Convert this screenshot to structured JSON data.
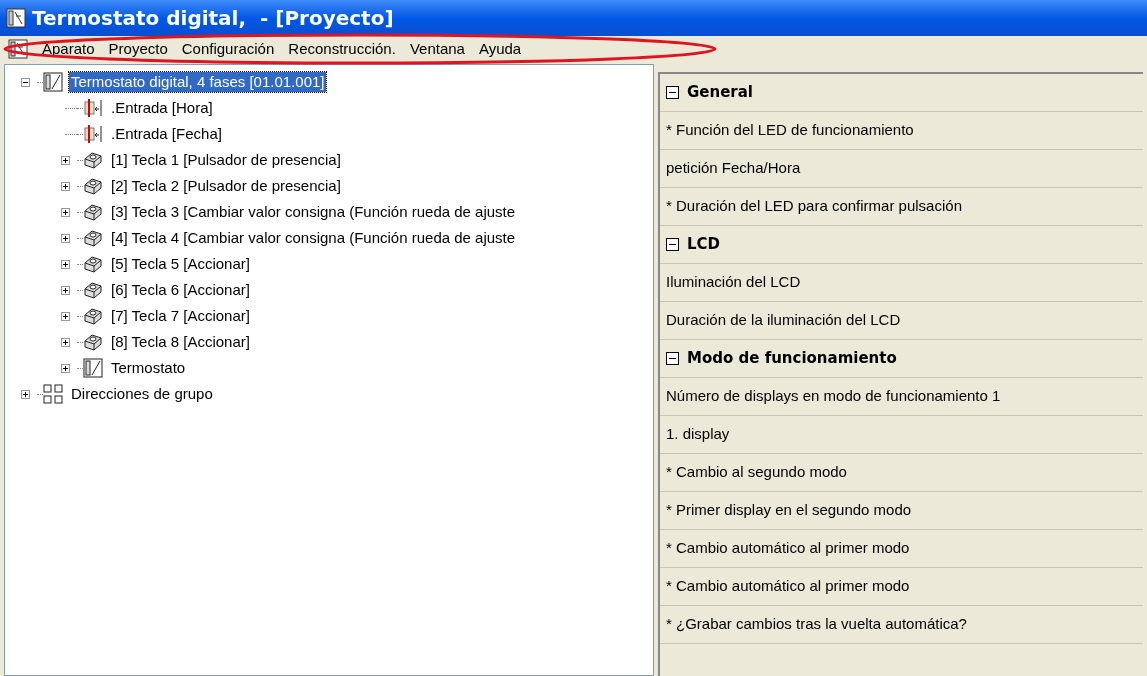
{
  "window": {
    "title": "Termostato digital,  - [Proyecto]"
  },
  "menu": [
    "Aparato",
    "Proyecto",
    "Configuración",
    "Reconstrucción.",
    "Ventana",
    "Ayuda"
  ],
  "annotation": {
    "kind": "ellipse",
    "color": "#e0141e"
  },
  "tree": [
    {
      "label": "Termostato digital, 4 fases [01.01.001]",
      "kind": "device",
      "expanded": true,
      "selected": true,
      "children": [
        {
          "label": ".Entrada [Hora]",
          "kind": "input",
          "selected": false
        },
        {
          "label": ".Entrada [Fecha]",
          "kind": "input",
          "selected": false
        },
        {
          "label": "[1] Tecla 1 [Pulsador de presencia]",
          "kind": "key",
          "expanded": false,
          "selected": false
        },
        {
          "label": "[2] Tecla 2 [Pulsador de presencia]",
          "kind": "key",
          "expanded": false,
          "selected": false
        },
        {
          "label": "[3] Tecla 3 [Cambiar valor consigna (Función rueda de ajuste",
          "kind": "key",
          "expanded": false,
          "selected": false
        },
        {
          "label": "[4] Tecla 4 [Cambiar valor consigna (Función rueda de ajuste",
          "kind": "key",
          "expanded": false,
          "selected": false
        },
        {
          "label": "[5] Tecla 5 [Accionar]",
          "kind": "key",
          "expanded": false,
          "selected": false
        },
        {
          "label": "[6] Tecla 6 [Accionar]",
          "kind": "key",
          "expanded": false,
          "selected": false
        },
        {
          "label": "[7] Tecla 7 [Accionar]",
          "kind": "key",
          "expanded": false,
          "selected": false
        },
        {
          "label": "[8] Tecla 8 [Accionar]",
          "kind": "key",
          "expanded": false,
          "selected": false
        },
        {
          "label": "Termostato",
          "kind": "device",
          "expanded": false,
          "selected": false
        }
      ]
    },
    {
      "label": "Direcciones de grupo",
      "kind": "group",
      "expanded": false,
      "selected": false
    }
  ],
  "parameters": [
    {
      "kind": "section",
      "label": "General",
      "expanded": true
    },
    {
      "kind": "param",
      "label": "* Función del LED de funcionamiento"
    },
    {
      "kind": "param",
      "label": "petición Fecha/Hora"
    },
    {
      "kind": "param",
      "label": "* Duración del LED para confirmar pulsación"
    },
    {
      "kind": "section",
      "label": "LCD",
      "expanded": true
    },
    {
      "kind": "param",
      "label": "Iluminación del LCD"
    },
    {
      "kind": "param",
      "label": "Duración de la iluminación del LCD"
    },
    {
      "kind": "section",
      "label": "Modo de funcionamiento",
      "expanded": true
    },
    {
      "kind": "param",
      "label": "Número de displays en modo de funcionamiento 1"
    },
    {
      "kind": "param",
      "label": "1. display"
    },
    {
      "kind": "param",
      "label": "* Cambio al segundo modo"
    },
    {
      "kind": "param",
      "label": "* Primer display en el segundo modo"
    },
    {
      "kind": "param",
      "label": "* Cambio automático al primer modo"
    },
    {
      "kind": "param",
      "label": "* Cambio automático al primer modo"
    },
    {
      "kind": "param",
      "label": "* ¿Grabar cambios tras la vuelta automática?"
    }
  ]
}
